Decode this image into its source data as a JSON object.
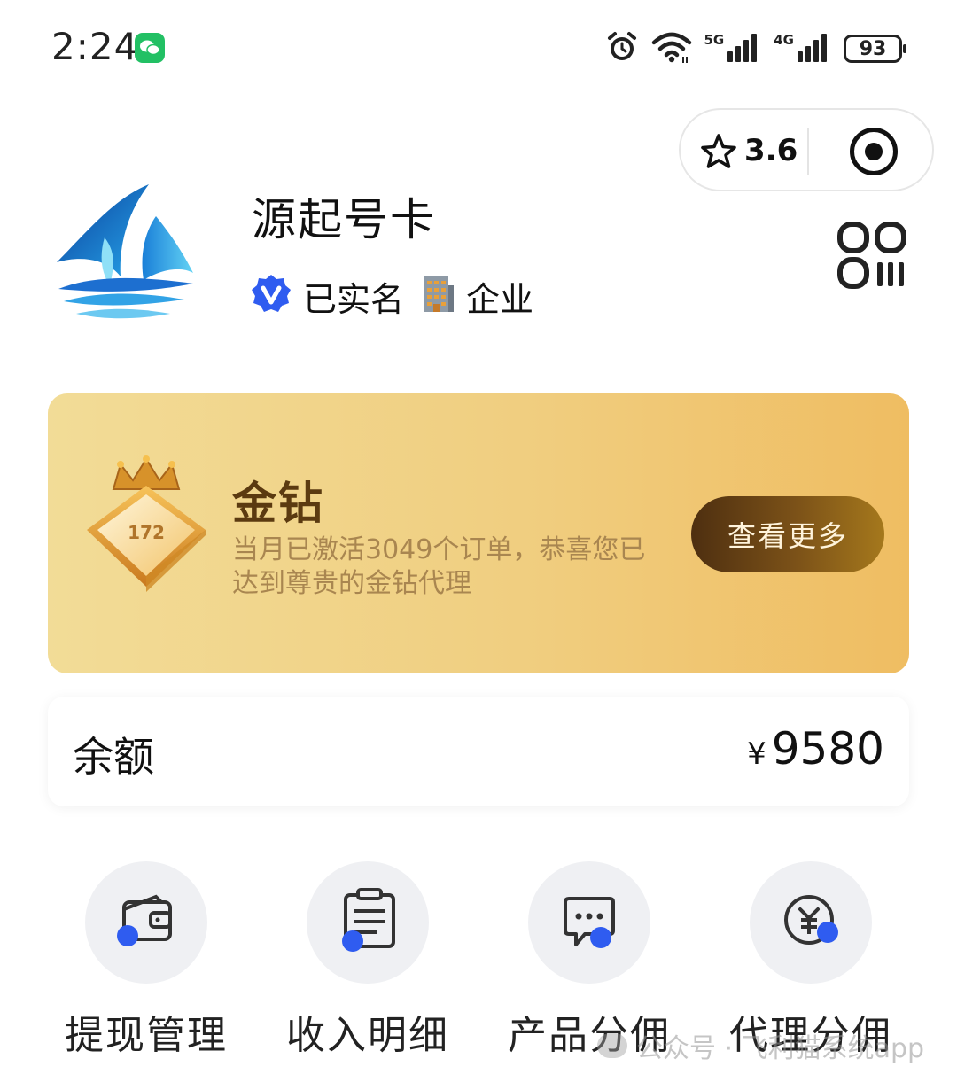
{
  "status_bar": {
    "time": "2:24",
    "signal_1_label": "5G",
    "signal_2_label": "4G",
    "battery": "93"
  },
  "capsule": {
    "rating": "3.6"
  },
  "profile": {
    "name": "源起号卡",
    "verified_label": "已实名",
    "type_label": "企业"
  },
  "level_card": {
    "badge_text": "172",
    "title": "金钻",
    "description": "当月已激活3049个订单，恭喜您已达到尊贵的金钻代理",
    "button_label": "查看更多"
  },
  "balance": {
    "label": "余额",
    "currency": "¥",
    "amount": "9580"
  },
  "menu": [
    {
      "label": "提现管理",
      "icon": "wallet-icon"
    },
    {
      "label": "收入明细",
      "icon": "clipboard-list-icon"
    },
    {
      "label": "产品分佣",
      "icon": "chat-bubble-icon"
    },
    {
      "label": "代理分佣",
      "icon": "yuan-coin-icon"
    }
  ],
  "watermark": {
    "text": "公众号 · 飞利猫系统app"
  },
  "colors": {
    "accent_blue": "#2f5cf0",
    "gold_start": "#f2dc97",
    "gold_end": "#efbd62",
    "button_brown": "#5a3814",
    "wechat_green": "#22c064"
  }
}
